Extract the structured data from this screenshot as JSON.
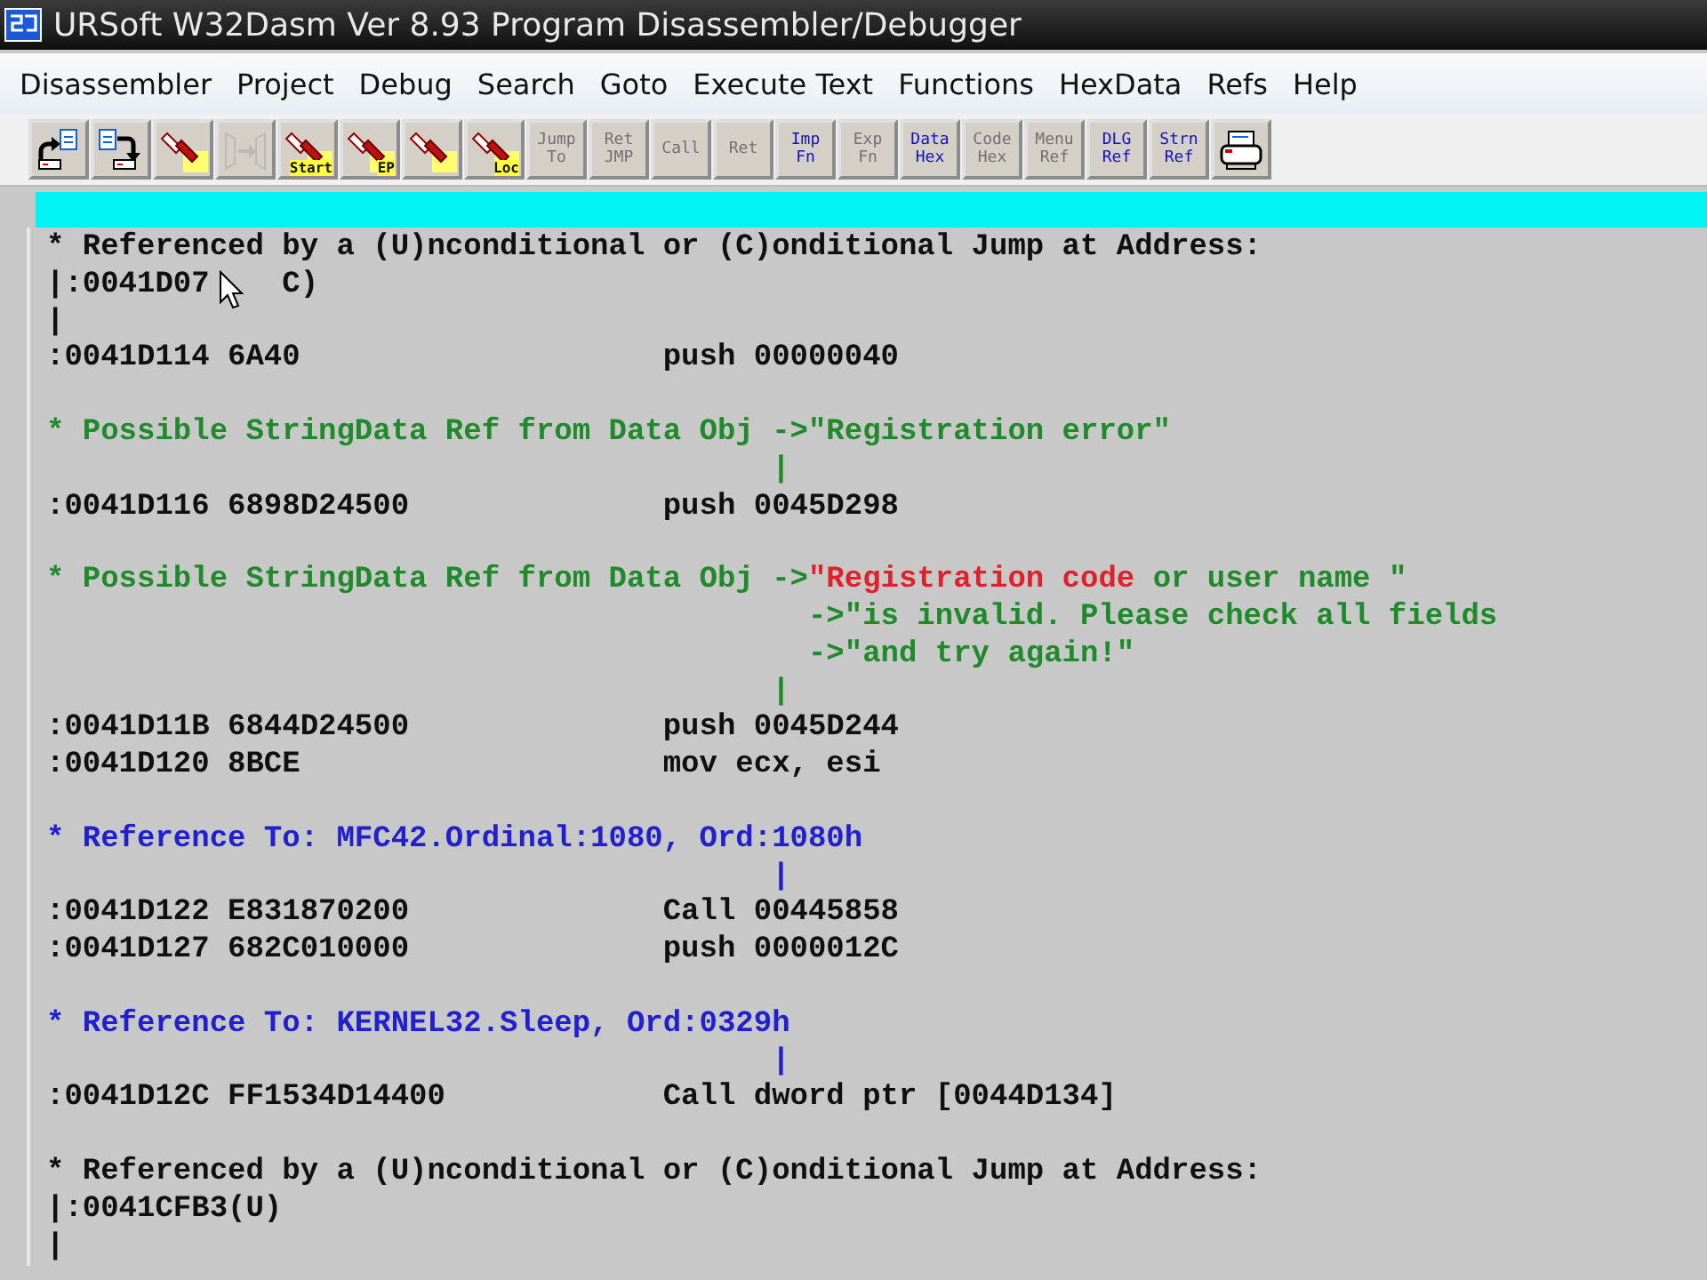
{
  "window": {
    "title": "URSoft W32Dasm Ver 8.93 Program Disassembler/Debugger"
  },
  "menu": [
    "Disassembler",
    "Project",
    "Debug",
    "Search",
    "Goto",
    "Execute Text",
    "Functions",
    "HexData",
    "Refs",
    "Help"
  ],
  "toolbar": [
    {
      "kind": "open",
      "disabled": false
    },
    {
      "kind": "save",
      "disabled": false
    },
    {
      "kind": "torch",
      "disabled": false
    },
    {
      "kind": "step",
      "disabled": true
    },
    {
      "kind": "torch",
      "disabled": false,
      "caption": "Start"
    },
    {
      "kind": "torch",
      "disabled": false,
      "caption": "EP"
    },
    {
      "kind": "torch",
      "disabled": false
    },
    {
      "kind": "torch",
      "disabled": false,
      "caption": "Loc"
    },
    {
      "kind": "text",
      "disabled": true,
      "top": "Jump",
      "bottom": "To"
    },
    {
      "kind": "text",
      "disabled": true,
      "top": "Ret",
      "bottom": "JMP"
    },
    {
      "kind": "text",
      "disabled": true,
      "top": "Call"
    },
    {
      "kind": "text",
      "disabled": true,
      "top": "Ret"
    },
    {
      "kind": "text",
      "disabled": false,
      "top": "Imp",
      "bottom": "Fn"
    },
    {
      "kind": "text",
      "disabled": true,
      "top": "Exp",
      "bottom": "Fn"
    },
    {
      "kind": "text",
      "disabled": false,
      "top": "Data",
      "bottom": "Hex"
    },
    {
      "kind": "text",
      "disabled": true,
      "top": "Code",
      "bottom": "Hex"
    },
    {
      "kind": "text",
      "disabled": true,
      "top": "Menu",
      "bottom": "Ref"
    },
    {
      "kind": "text",
      "disabled": false,
      "top": "DLG",
      "bottom": "Ref"
    },
    {
      "kind": "text",
      "disabled": false,
      "top": "Strn",
      "bottom": "Ref"
    },
    {
      "kind": "print",
      "disabled": false
    }
  ],
  "listing": [
    {
      "kind": "text",
      "segments": [
        {
          "text": "* Referenced by a (U)nconditional or (C)onditional Jump at Address:",
          "color": "#101010"
        }
      ]
    },
    {
      "kind": "covered",
      "segments": [
        {
          "text": "|:0041D07",
          "color": "#101010"
        },
        {
          "text": "C)",
          "color": "#101010"
        }
      ]
    },
    {
      "kind": "text",
      "segments": [
        {
          "text": "|",
          "color": "#101010"
        }
      ]
    },
    {
      "kind": "text",
      "segments": [
        {
          "text": ":0041D114 6A40                    push 00000040",
          "color": "#101010"
        }
      ]
    },
    {
      "kind": "blank"
    },
    {
      "kind": "text",
      "segments": [
        {
          "text": "* Possible StringData Ref from Data Obj ->\"Registration error\"",
          "color": "#1e8a2a"
        }
      ]
    },
    {
      "kind": "text",
      "segments": [
        {
          "text": "                                        |",
          "color": "#1e8a2a"
        }
      ]
    },
    {
      "kind": "text",
      "segments": [
        {
          "text": ":0041D116 6898D24500              push 0045D298",
          "color": "#101010"
        }
      ]
    },
    {
      "kind": "blank"
    },
    {
      "kind": "text",
      "segments": [
        {
          "text": "* Possible StringData Ref from Data Obj ->",
          "color": "#1e8a2a"
        },
        {
          "text": "\"Registration code",
          "color": "#e0202a"
        },
        {
          "text": " or user name \"",
          "color": "#1e8a2a"
        }
      ]
    },
    {
      "kind": "text",
      "segments": [
        {
          "text": "                                          ->\"is invalid. Please check all fields",
          "color": "#1e8a2a"
        }
      ]
    },
    {
      "kind": "text",
      "segments": [
        {
          "text": "                                          ->\"and try again!\"",
          "color": "#1e8a2a"
        }
      ]
    },
    {
      "kind": "text",
      "segments": [
        {
          "text": "                                        |",
          "color": "#1e8a2a"
        }
      ]
    },
    {
      "kind": "text",
      "segments": [
        {
          "text": ":0041D11B 6844D24500              push 0045D244",
          "color": "#101010"
        }
      ]
    },
    {
      "kind": "text",
      "segments": [
        {
          "text": ":0041D120 8BCE                    mov ecx, esi",
          "color": "#101010"
        }
      ]
    },
    {
      "kind": "blank"
    },
    {
      "kind": "text",
      "segments": [
        {
          "text": "* Reference To: MFC42.Ordinal:1080, Ord:1080h",
          "color": "#2020d0"
        }
      ]
    },
    {
      "kind": "text",
      "segments": [
        {
          "text": "                                        |",
          "color": "#2020d0"
        }
      ]
    },
    {
      "kind": "text",
      "segments": [
        {
          "text": ":0041D122 E831870200              Call 00445858",
          "color": "#101010"
        }
      ]
    },
    {
      "kind": "text",
      "segments": [
        {
          "text": ":0041D127 682C010000              push 0000012C",
          "color": "#101010"
        }
      ]
    },
    {
      "kind": "blank"
    },
    {
      "kind": "text",
      "segments": [
        {
          "text": "* Reference To: KERNEL32.Sleep, Ord:0329h",
          "color": "#2020d0"
        }
      ]
    },
    {
      "kind": "text",
      "segments": [
        {
          "text": "                                        |",
          "color": "#2020d0"
        }
      ]
    },
    {
      "kind": "text",
      "segments": [
        {
          "text": ":0041D12C FF1534D14400            Call dword ptr [0044D134]",
          "color": "#101010"
        }
      ]
    },
    {
      "kind": "blank"
    },
    {
      "kind": "text",
      "segments": [
        {
          "text": "* Referenced by a (U)nconditional or (C)onditional Jump at Address:",
          "color": "#101010"
        }
      ]
    },
    {
      "kind": "text",
      "segments": [
        {
          "text": "|:0041CFB3(U)",
          "color": "#101010"
        }
      ]
    },
    {
      "kind": "text",
      "segments": [
        {
          "text": "|",
          "color": "#101010"
        }
      ]
    }
  ]
}
